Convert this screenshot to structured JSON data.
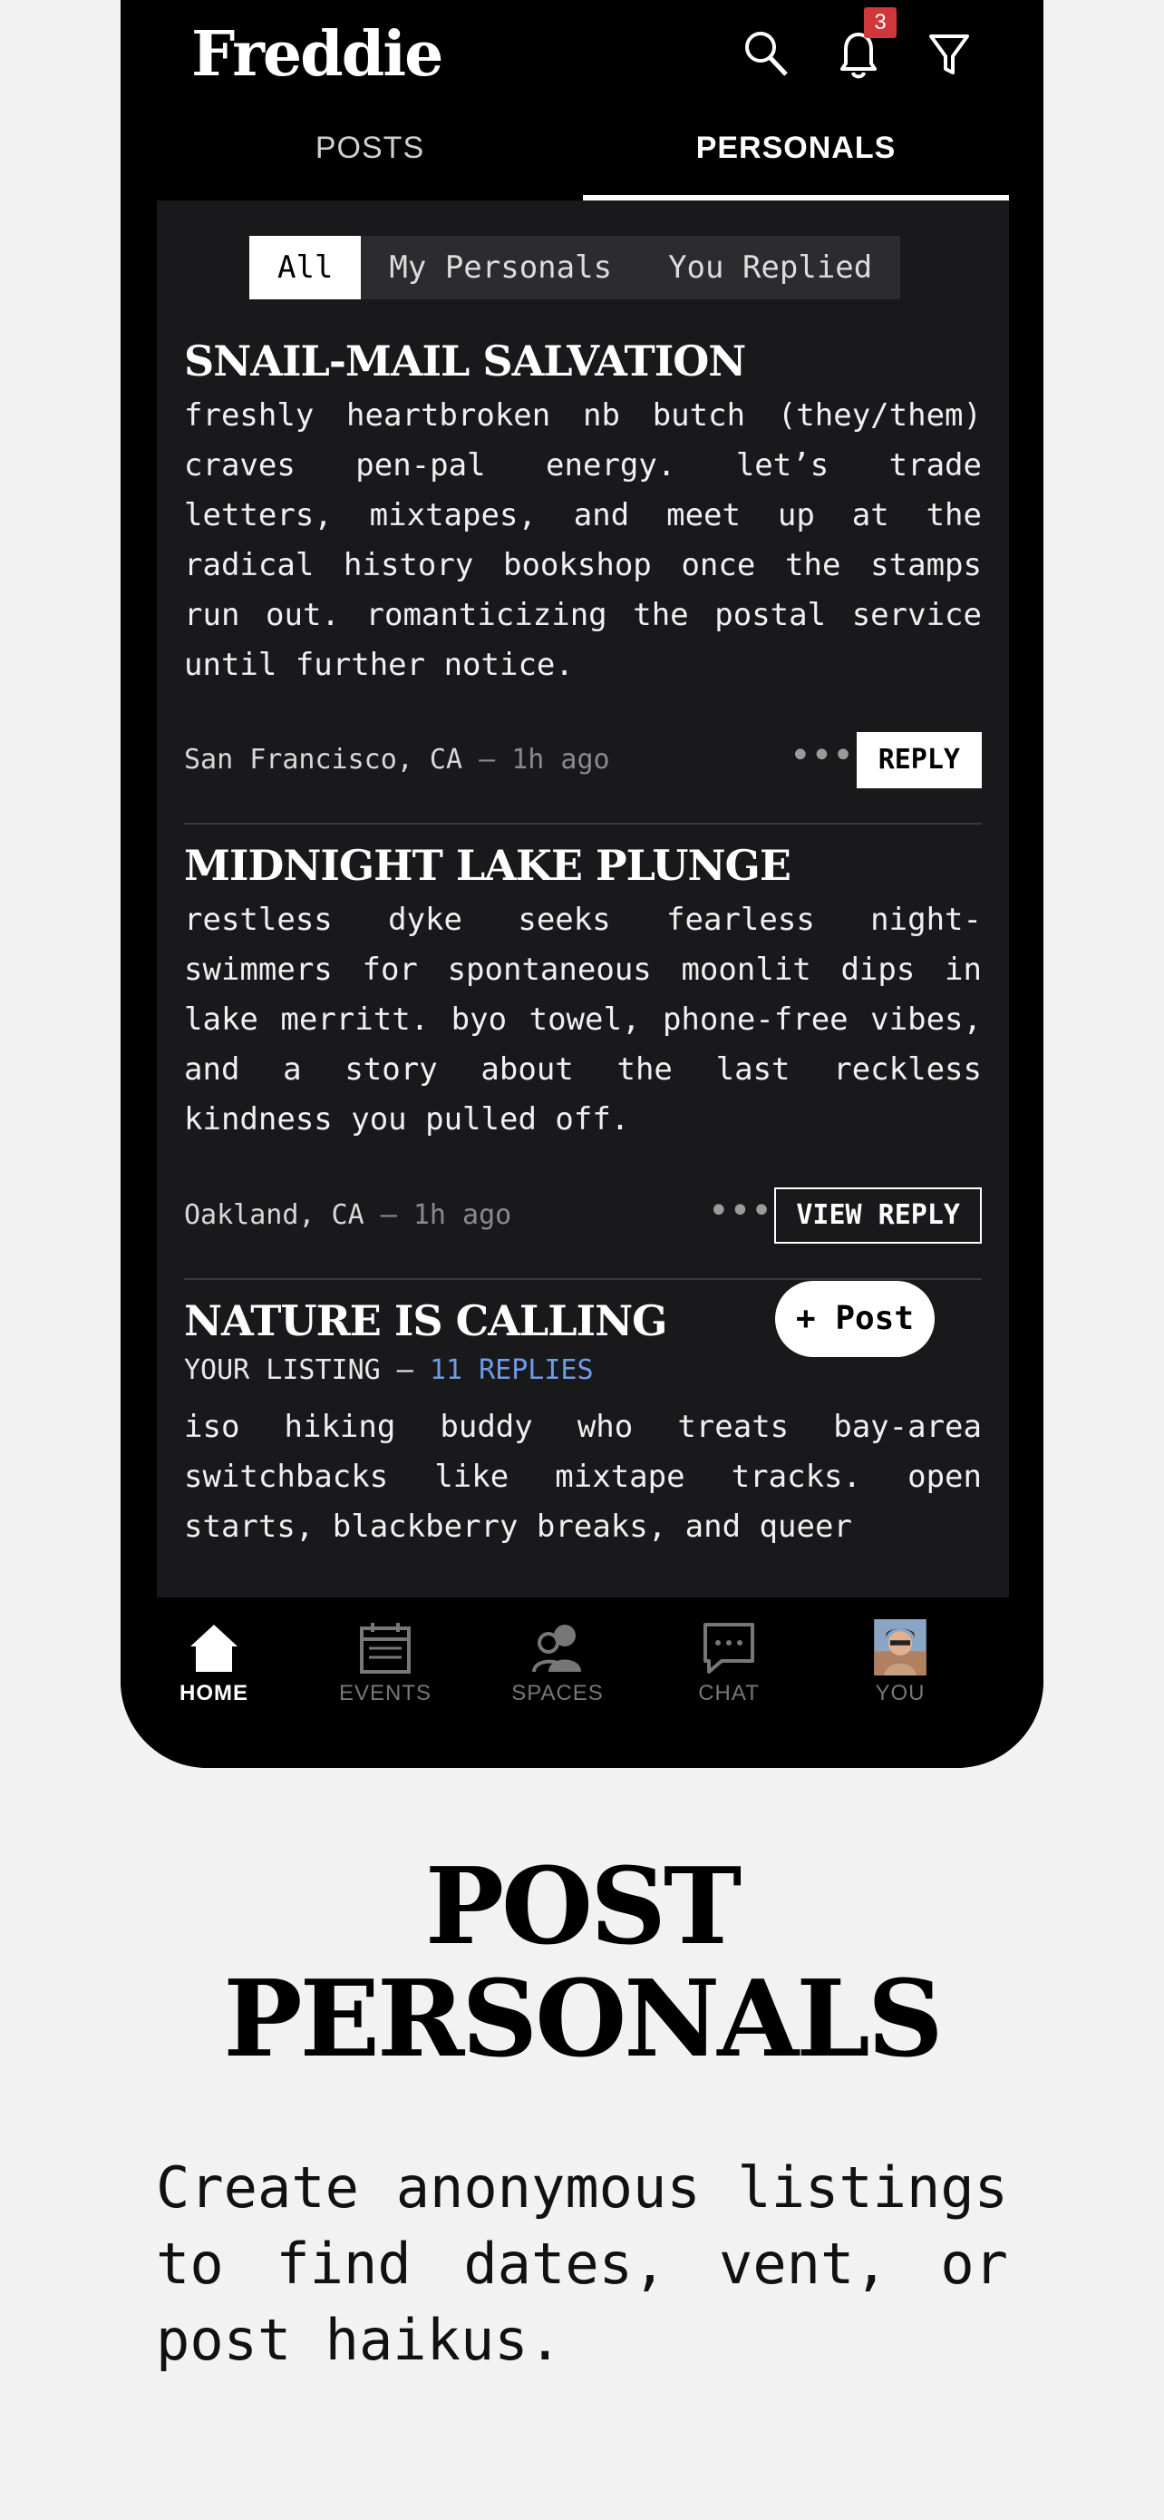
{
  "app": {
    "title": "Freddie",
    "notification_count": "3"
  },
  "tabs": [
    {
      "label": "POSTS",
      "active": false
    },
    {
      "label": "PERSONALS",
      "active": true
    }
  ],
  "filters": [
    "All",
    "My Personals",
    "You Replied"
  ],
  "posts": [
    {
      "title": "SNAIL-MAIL SALVATION",
      "body": "freshly heartbroken nb butch (they/them) craves pen-pal energy. let’s trade letters, mixtapes, and meet up at the radical history bookshop once the stamps run out. romanticizing the postal service until further notice.",
      "location": "San Francisco, CA",
      "time": "– 1h ago",
      "action": "REPLY"
    },
    {
      "title": "MIDNIGHT LAKE PLUNGE",
      "body": "restless dyke seeks fearless night-swimmers for spontaneous moonlit dips in lake merritt. byo towel, phone-free vibes, and a story about the last reckless kindness you pulled off.",
      "location": "Oakland, CA",
      "time": "– 1h ago",
      "action": "VIEW REPLY"
    },
    {
      "title": "NATURE IS CALLING",
      "listing_label": "YOUR LISTING –",
      "replies": "11 REPLIES",
      "body": "iso hiking buddy who treats bay-area switchbacks like mixtape tracks. open starts, blackberry breaks, and queer"
    }
  ],
  "fab_label": "+ Post",
  "nav": [
    {
      "label": "HOME",
      "icon": "home-icon",
      "active": true
    },
    {
      "label": "EVENTS",
      "icon": "calendar-icon",
      "active": false
    },
    {
      "label": "SPACES",
      "icon": "people-icon",
      "active": false
    },
    {
      "label": "CHAT",
      "icon": "chat-icon",
      "active": false
    },
    {
      "label": "YOU",
      "icon": "avatar",
      "active": false
    }
  ],
  "marketing": {
    "headline_line1": "POST",
    "headline_line2": "PERSONALS",
    "subtext": "Create anonymous listings to find dates, vent, or post haikus."
  }
}
